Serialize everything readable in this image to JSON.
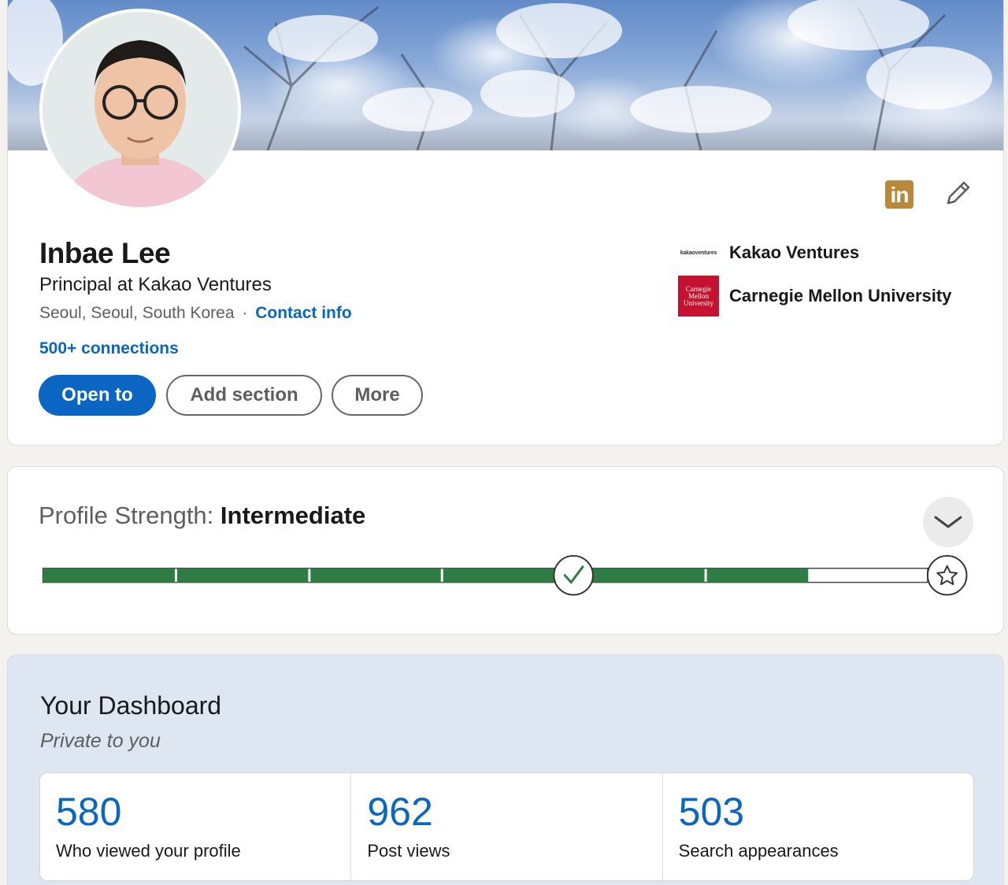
{
  "profile": {
    "name": "Inbae Lee",
    "headline": "Principal at Kakao Ventures",
    "location": "Seoul, Seoul, South Korea",
    "separator": "·",
    "contact_info": "Contact info",
    "connections": "500+ connections",
    "buttons": {
      "open_to": "Open to",
      "add_section": "Add section",
      "more": "More"
    },
    "brand_icon": "in",
    "organizations": [
      {
        "logo_text": "kakaoventures",
        "name": "Kakao Ventures"
      },
      {
        "logo_text": "Carnegie Mellon University",
        "name": "Carnegie Mellon University"
      }
    ]
  },
  "strength": {
    "label": "Profile Strength:",
    "level": "Intermediate",
    "progress_fraction": 0.865,
    "milestone_icon": "check-icon",
    "goal_icon": "star-icon"
  },
  "dashboard": {
    "title": "Your Dashboard",
    "subtitle": "Private to you",
    "stats": [
      {
        "value": "580",
        "label": "Who viewed your profile"
      },
      {
        "value": "962",
        "label": "Post views"
      },
      {
        "value": "503",
        "label": "Search appearances"
      }
    ]
  },
  "colors": {
    "accent": "#0a66c2",
    "progress": "#2e7d45",
    "linkedin_icon": "#b8893b",
    "cmu_red": "#c41230"
  }
}
